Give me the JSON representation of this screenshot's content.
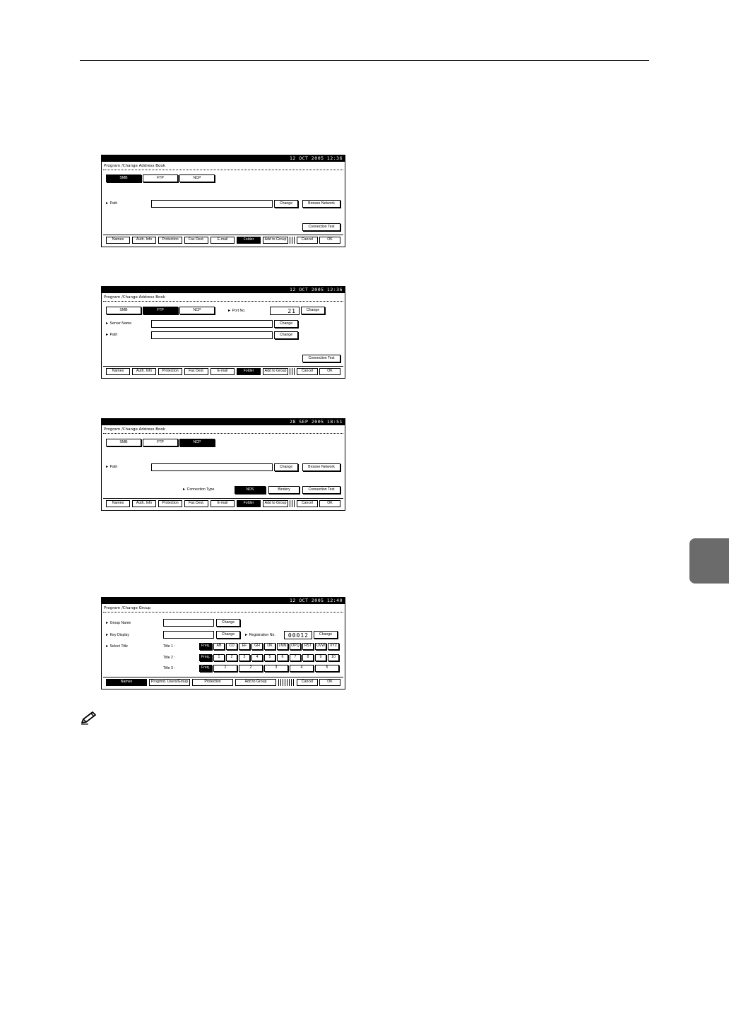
{
  "panels": [
    {
      "clock": "12 OCT 2005 12:36",
      "title": "Program /Change Address Book",
      "protocol_tabs": [
        "SMB",
        "FTP",
        "NCP"
      ],
      "path_label": "► Path",
      "change_label": "Change",
      "browse_label": "Browse Network",
      "connection_test_label": "Connection Test"
    },
    {
      "clock": "12 OCT 2005 12:36",
      "title": "Program /Change Address Book",
      "protocol_tabs": [
        "SMB",
        "FTP",
        "NCP"
      ],
      "port_label": "► Port No.",
      "port_value": "21",
      "server_label": "► Server Name",
      "path_label": "► Path",
      "change_label": "Change",
      "connection_test_label": "Connection Test"
    },
    {
      "clock": "28 SEP 2005 18:51",
      "title": "Program /Change Address Book",
      "protocol_tabs": [
        "SMB",
        "FTP",
        "NCP"
      ],
      "path_label": "► Path",
      "change_label": "Change",
      "browse_label": "Browse Network",
      "connection_type_label": "► Connection Type",
      "nds_label": "NDS",
      "bindery_label": "Bindery",
      "connection_test_label": "Connection Test"
    },
    {
      "clock": "12 OCT 2005 12:40",
      "title": "Program /Change Group",
      "group_name_label": "► Group Name",
      "key_display_label": "► Key Display",
      "select_title_label": "► Select Title",
      "registration_label": "► Registration No.",
      "registration_value": "00012",
      "change_label": "Change",
      "title1_label": "Title 1 :",
      "title2_label": "Title 2 :",
      "title3_label": "Title 3 :",
      "title1_keys": [
        "Freq.",
        "AB",
        "CD",
        "EF",
        "GH",
        "IJK",
        "LMN",
        "OPQ",
        "RST",
        "UVW",
        "XYZ"
      ],
      "title2_keys": [
        "Freq.",
        "1",
        "2",
        "3",
        "4",
        "5",
        "6",
        "7",
        "8",
        "9",
        "10"
      ],
      "title3_keys": [
        "Freq.",
        "1",
        "2",
        "3",
        "4",
        "5"
      ],
      "bottom_tabs": [
        "Names",
        "Progrmd. Users/Group",
        "Protection",
        "Add to Group"
      ],
      "cancel_label": "Cancel",
      "ok_label": "OK"
    }
  ],
  "address_tabs": [
    "Names",
    "Auth. Info",
    "Protection",
    "Fax Dest.",
    "E-mail",
    "Folder",
    "Add to Group"
  ],
  "cancel_label": "Cancel",
  "ok_label": "OK",
  "note_icon": "pencil-icon"
}
